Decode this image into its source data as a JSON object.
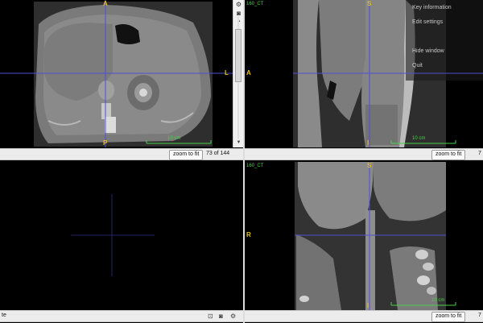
{
  "views": {
    "axial": {
      "orient_top": "A",
      "orient_bottom": "P",
      "orient_right": "L",
      "scale_label": "10 cm",
      "zoom_label": "zoom to fit",
      "slice_info": "73 of 144"
    },
    "sagittal": {
      "series_label": "160_CT",
      "orient_top": "S",
      "orient_bottom": "I",
      "orient_left": "A",
      "scale_label": "10 cm",
      "zoom_label": "zoom to fit",
      "slice_info_partial": "7",
      "menu_items": [
        "Key information",
        "Edit settings",
        "Hide window",
        "Quit"
      ]
    },
    "volume": {
      "left_text": "te"
    },
    "coronal": {
      "series_label": "160_CT",
      "orient_top": "S",
      "orient_bottom": "I",
      "orient_left": "R",
      "scale_label": "10 cm",
      "zoom_label": "zoom to fit",
      "slice_info_partial": "7"
    }
  },
  "colors": {
    "orientation": "#e8c020",
    "crosshair": "#5050d0",
    "scale": "#48d048"
  }
}
